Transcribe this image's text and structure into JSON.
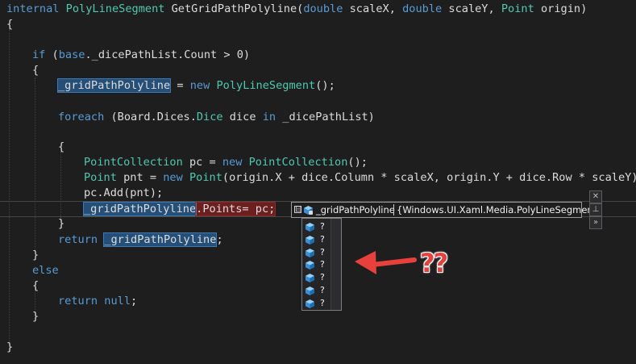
{
  "code": {
    "l1": {
      "kw_internal": "internal",
      "type_ret": "PolyLineSegment",
      "method": "GetGridPathPolyline(",
      "kw_double1": "double",
      "p1": "scaleX, ",
      "kw_double2": "double",
      "p2": "scaleY, ",
      "type_point": "Point",
      "p3": "origin)"
    },
    "l2": "{",
    "l4": {
      "kw_if": "if",
      "p1": " (",
      "kw_base": "base",
      "p2": "._dicePathList.Count > 0)"
    },
    "l5": "{",
    "l6": {
      "field": "_gridPathPolyline",
      "p1": " = ",
      "kw_new": "new",
      "type": "PolyLineSegment",
      "p2": "();"
    },
    "l8": {
      "kw_foreach": "foreach",
      "p1": " (Board.Dices.",
      "type_dice": "Dice",
      "p2": " dice ",
      "kw_in": "in",
      "p3": " _dicePathList)"
    },
    "l10": "{",
    "l11": {
      "type1": "PointCollection",
      "p1": " pc = ",
      "kw_new": "new",
      "type2": "PointCollection",
      "p2": "();"
    },
    "l12": {
      "type1": "Point",
      "p1": " pnt = ",
      "kw_new": "new",
      "type2": "Point",
      "p2": "(origin.X + dice.Column * scaleX, origin.Y + dice.Row * scaleY);"
    },
    "l13": "pc.Add(pnt);",
    "l14": {
      "field": "_gridPathPolyline",
      "rest": ".Points= pc;"
    },
    "l15": "}",
    "l16": {
      "kw_return": "return",
      "field": "_gridPathPolyline",
      "p": ";"
    },
    "l17": "}",
    "l18": {
      "kw_else": "else"
    },
    "l19": "{",
    "l20": {
      "kw_return": "return",
      "kw_null": "null",
      "p": ";"
    },
    "l21": "}",
    "l23": "}"
  },
  "datatip": {
    "expander": "⊟",
    "name": "_gridPathPolyline",
    "value": "{Windows.UI.Xaml.Media.PolyLineSegment}",
    "close_glyph": "✕",
    "pin_glyph": "⊥",
    "expand_glyph": "»"
  },
  "dropdown": {
    "items": [
      "?",
      "?",
      "?",
      "?",
      "?",
      "?",
      "?"
    ],
    "icon": "cube-icon"
  },
  "annotation": {
    "text": "??",
    "color": "#e8413c"
  }
}
